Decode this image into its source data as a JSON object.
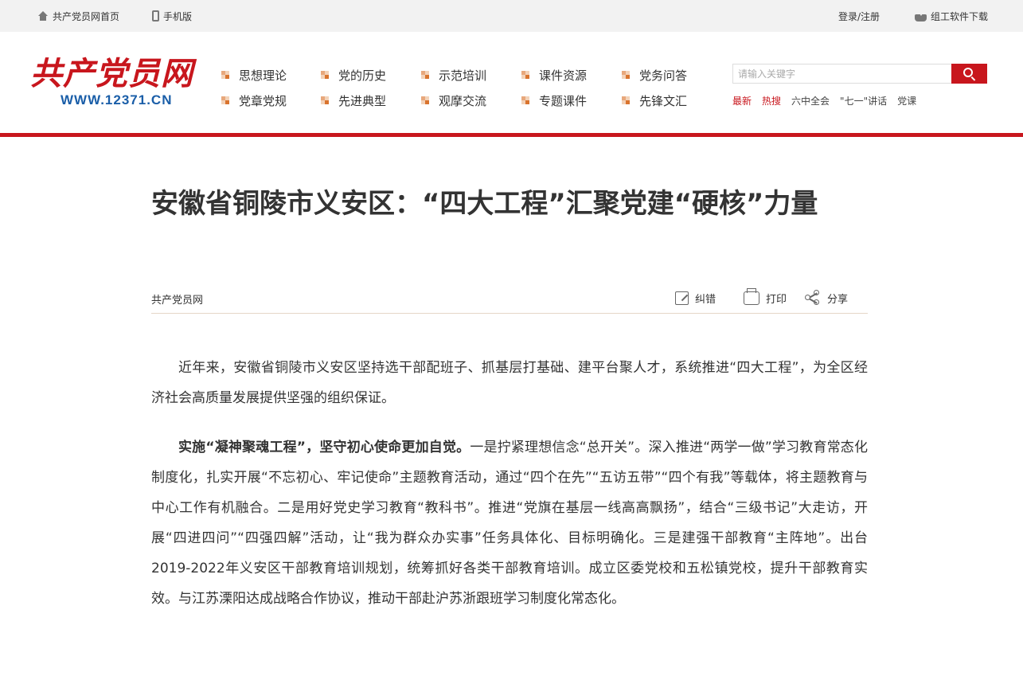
{
  "topbar": {
    "home_label": "共产党员网首页",
    "mobile_label": "手机版",
    "login_label": "登录/注册",
    "download_label": "组工软件下载"
  },
  "logo": {
    "cn": "共产党员网",
    "url": "WWW.12371.CN"
  },
  "nav": {
    "items": [
      "思想理论",
      "党的历史",
      "示范培训",
      "课件资源",
      "党务问答",
      "党章党规",
      "先进典型",
      "观摩交流",
      "专题课件",
      "先锋文汇"
    ]
  },
  "search": {
    "placeholder": "请输入关键字"
  },
  "hot_links": [
    "最新",
    "热搜",
    "六中全会",
    "\"七一\"讲话",
    "党课"
  ],
  "article": {
    "title": "安徽省铜陵市义安区：“四大工程”汇聚党建“硬核”力量",
    "source": "共产党员网",
    "tools": {
      "correct": "纠错",
      "print": "打印",
      "share": "分享"
    },
    "p1": "近年来，安徽省铜陵市义安区坚持选干部配班子、抓基层打基础、建平台聚人才，系统推进“四大工程”，为全区经济社会高质量发展提供坚强的组织保证。",
    "p2_bold": "实施“凝神聚魂工程”，坚守初心使命更加自觉。",
    "p2_text": "一是拧紧理想信念“总开关”。深入推进“两学一做”学习教育常态化制度化，扎实开展“不忘初心、牢记使命”主题教育活动，通过“四个在先”“五访五带”“四个有我”等载体，将主题教育与中心工作有机融合。二是用好党史学习教育“教科书”。推进“党旗在基层一线高高飘扬”，结合“三级书记”大走访，开展“四进四问”“四强四解”活动，让“我为群众办实事”任务具体化、目标明确化。三是建强干部教育“主阵地”。出台2019-2022年义安区干部教育培训规划，统筹抓好各类干部教育培训。成立区委党校和五松镇党校，提升干部教育实效。与江苏溧阳达成战略合作协议，推动干部赴沪苏浙跟班学习制度化常态化。"
  },
  "colors": {
    "brand_red": "#c8161d",
    "url_blue": "#1a5ea8"
  }
}
